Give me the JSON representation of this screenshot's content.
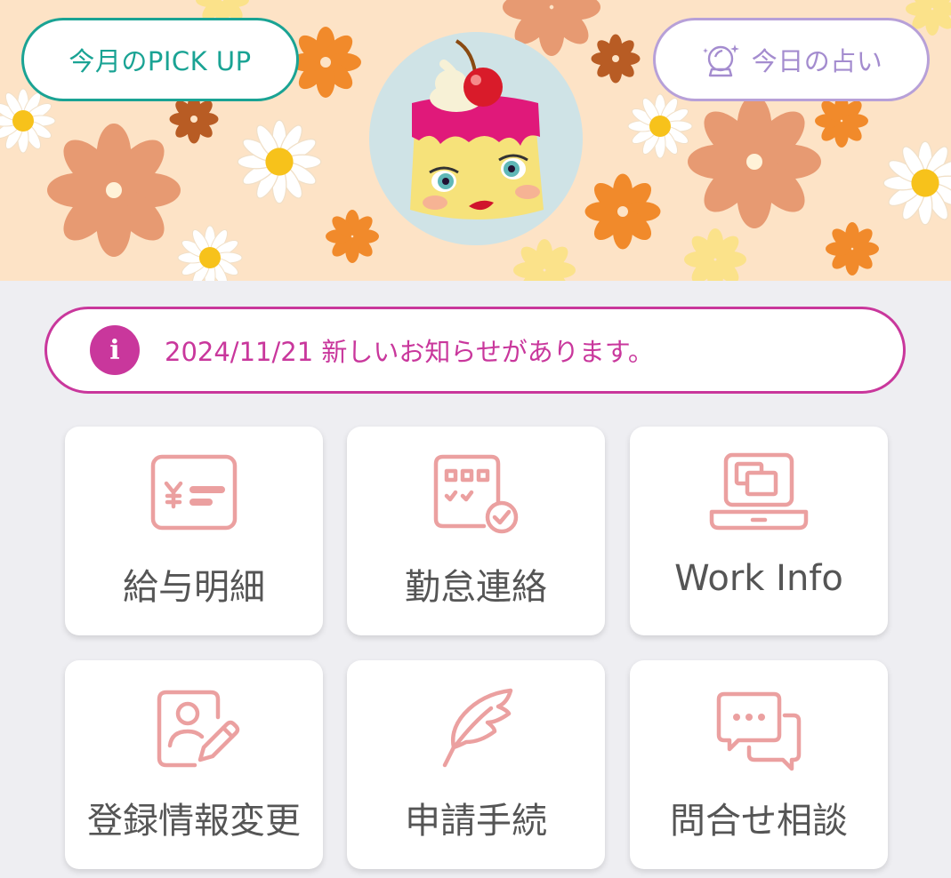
{
  "header": {
    "pickup_label": "今月のPICK UP",
    "fortune_label": "今日の占い",
    "fortune_icon": "crystal-ball-icon",
    "mascot": "pudding-mascot",
    "colors": {
      "banner_bg": "#fde3c6",
      "pickup": "#1aa394",
      "fortune": "#a48ccf"
    }
  },
  "notice": {
    "icon_glyph": "i",
    "text": "2024/11/21 新しいお知らせがあります。",
    "color": "#c9379c"
  },
  "menu": {
    "icon_color": "#eba0a0",
    "items": [
      {
        "label": "給与明細",
        "icon": "payslip-icon"
      },
      {
        "label": "勤怠連絡",
        "icon": "attendance-calendar-icon"
      },
      {
        "label": "Work Info",
        "icon": "laptop-icon"
      },
      {
        "label": "登録情報変更",
        "icon": "profile-edit-icon"
      },
      {
        "label": "申請手続",
        "icon": "quill-pen-icon"
      },
      {
        "label": "問合せ相談",
        "icon": "chat-bubbles-icon"
      }
    ]
  }
}
